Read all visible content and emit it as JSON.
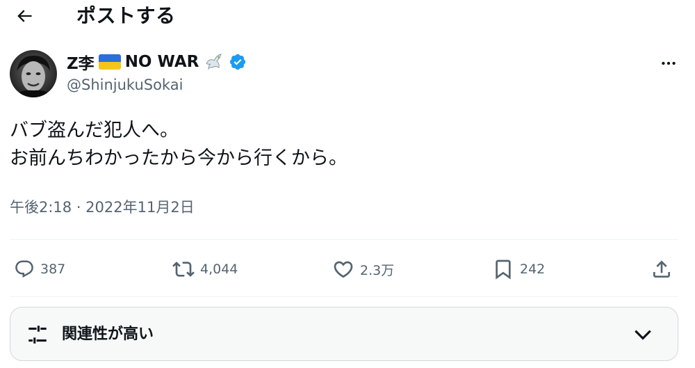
{
  "header": {
    "title": "ポストする",
    "back_icon": "arrow-left-icon"
  },
  "author": {
    "display_name": "Z李",
    "name_suffix": "NO WAR",
    "handle": "@ShinjukuSokai",
    "verified": true,
    "flag": "ukraine-flag",
    "flag_colors": [
      "#2a6fdb",
      "#f5c518"
    ],
    "verified_color": "#1d9bf0"
  },
  "tweet": {
    "lines": [
      "バブ盗んだ犯人へ。",
      "お前んちわかったから今から行くから。"
    ],
    "timestamp": "午後2:18 · 2022年11月2日"
  },
  "actions": {
    "reply_count": "387",
    "retweet_count": "4,044",
    "like_count": "2.3万",
    "bookmark_count": "242"
  },
  "sort": {
    "label": "関連性が高い"
  },
  "colors": {
    "text": "#0f1419",
    "secondary": "#536471",
    "divider": "#eff3f4"
  }
}
